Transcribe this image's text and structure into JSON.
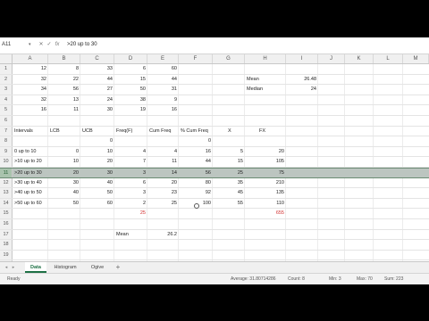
{
  "formula_bar": {
    "name_box": "A11",
    "name_box_arrow": "▾",
    "cancel": "✕",
    "enter": "✓",
    "fx": "fx",
    "content": ">20 up to 30"
  },
  "columns": [
    "A",
    "B",
    "C",
    "D",
    "E",
    "F",
    "G",
    "H",
    "I",
    "J",
    "K",
    "L",
    "M"
  ],
  "rows": {
    "r1": {
      "num": "1",
      "A": "12",
      "B": "8",
      "C": "33",
      "D": "6",
      "E": "60",
      "H": "",
      "I": ""
    },
    "r2": {
      "num": "2",
      "A": "32",
      "B": "22",
      "C": "44",
      "D": "15",
      "E": "44",
      "H": "Mean",
      "I": "26.48"
    },
    "r3": {
      "num": "3",
      "A": "34",
      "B": "56",
      "C": "27",
      "D": "50",
      "E": "31",
      "H": "Median",
      "I": "24"
    },
    "r4": {
      "num": "4",
      "A": "32",
      "B": "13",
      "C": "24",
      "D": "38",
      "E": "9"
    },
    "r5": {
      "num": "5",
      "A": "16",
      "B": "11",
      "C": "30",
      "D": "19",
      "E": "16"
    },
    "r6": {
      "num": "6"
    },
    "r7": {
      "num": "7",
      "A": "Intervals",
      "B": "LCB",
      "C": "UCB",
      "D": "Freq(F)",
      "E": "Cum Freq",
      "F": "% Cum Freq",
      "G": "X",
      "H": "FX"
    },
    "r8": {
      "num": "8",
      "C": "0",
      "F": "0"
    },
    "r9": {
      "num": "9",
      "A": "0 up to 10",
      "B": "0",
      "C": "10",
      "D": "4",
      "E": "4",
      "F": "16",
      "G": "5",
      "H": "20"
    },
    "r10": {
      "num": "10",
      "A": ">10 up to 20",
      "B": "10",
      "C": "20",
      "D": "7",
      "E": "11",
      "F": "44",
      "G": "15",
      "H": "105"
    },
    "r11": {
      "num": "11",
      "A": ">20 up to 30",
      "B": "20",
      "C": "30",
      "D": "3",
      "E": "14",
      "F": "56",
      "G": "25",
      "H": "75"
    },
    "r12": {
      "num": "12",
      "A": ">30 up to 40",
      "B": "30",
      "C": "40",
      "D": "6",
      "E": "20",
      "F": "80",
      "G": "35",
      "H": "210"
    },
    "r13": {
      "num": "13",
      "A": ">40 up to 50",
      "B": "40",
      "C": "50",
      "D": "3",
      "E": "23",
      "F": "92",
      "G": "45",
      "H": "135"
    },
    "r14": {
      "num": "14",
      "A": ">50 up to 60",
      "B": "50",
      "C": "60",
      "D": "2",
      "E": "25",
      "F": "100",
      "G": "55",
      "H": "110"
    },
    "r15": {
      "num": "15",
      "D": "25",
      "H": "655"
    },
    "r16": {
      "num": "16"
    },
    "r17": {
      "num": "17",
      "D": "Mean",
      "E": "26.2"
    },
    "r18": {
      "num": "18"
    },
    "r19": {
      "num": "19"
    },
    "r20": {
      "num": "20"
    }
  },
  "sheet_tabs": {
    "prev": "◂",
    "next": "▸",
    "tabs": [
      "Data",
      "Histogram",
      "Ogive"
    ],
    "add": "+"
  },
  "status_bar": {
    "ready": "Ready",
    "average": "Average: 31.80714286",
    "count": "Count: 8",
    "min": "Min: 3",
    "max": "Max: 70",
    "sum": "Sum: 223"
  },
  "colors": {
    "accent": "#1e7145",
    "selected_row": "#bcc5c0",
    "total_red": "#d23030"
  }
}
